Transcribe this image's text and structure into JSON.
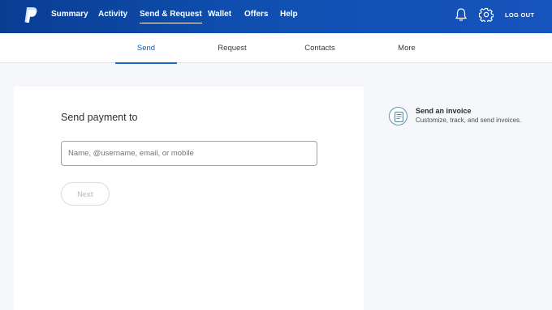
{
  "colors": {
    "header_bg": "#0f4fb0",
    "accent": "#1a67c4",
    "page_bg": "#f5f7fa"
  },
  "topnav": {
    "logo_icon": "paypal-logo",
    "items": [
      {
        "label": "Summary"
      },
      {
        "label": "Activity"
      },
      {
        "label": "Send & Request",
        "active": true
      },
      {
        "label": "Wallet"
      },
      {
        "label": "Offers"
      },
      {
        "label": "Help"
      }
    ],
    "notifications_icon": "bell-icon",
    "settings_icon": "gear-icon",
    "logout_label": "LOG OUT"
  },
  "subnav": {
    "tabs": [
      {
        "label": "Send",
        "active": true
      },
      {
        "label": "Request"
      },
      {
        "label": "Contacts"
      },
      {
        "label": "More"
      }
    ]
  },
  "send_card": {
    "title": "Send payment to",
    "recipient_input": {
      "value": "",
      "placeholder": "Name, @username, email, or mobile"
    },
    "next_label": "Next"
  },
  "sidebar": {
    "invoice": {
      "icon": "invoice-icon",
      "title": "Send an invoice",
      "subtitle": "Customize, track, and send invoices."
    }
  }
}
